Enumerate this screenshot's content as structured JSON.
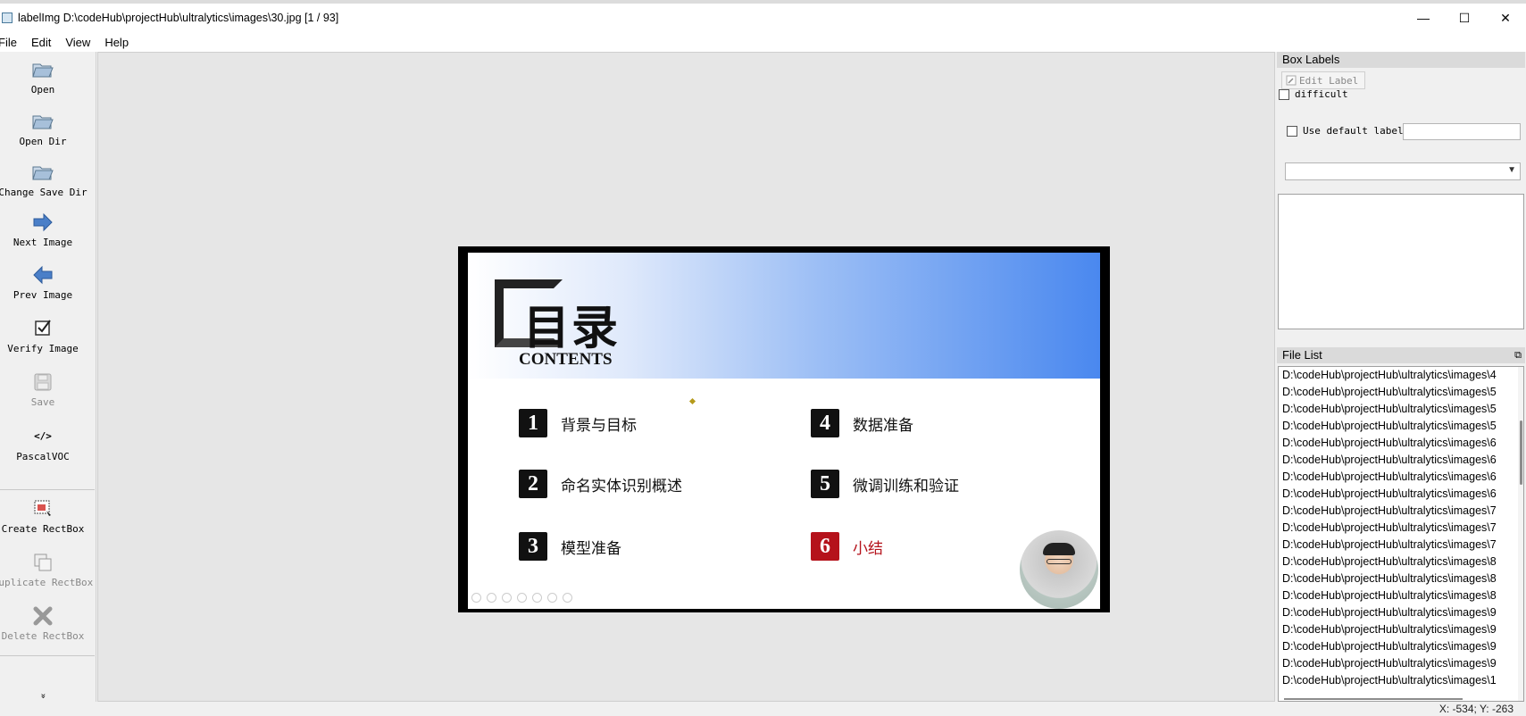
{
  "window": {
    "title": "labelImg D:\\codeHub\\projectHub\\ultralytics\\images\\30.jpg [1 / 93]",
    "minimize": "—",
    "maximize": "☐",
    "close": "✕"
  },
  "menu": [
    "File",
    "Edit",
    "View",
    "Help"
  ],
  "toolbar": {
    "open": "Open",
    "open_dir": "Open Dir",
    "change_save_dir": "Change Save Dir",
    "next_image": "Next Image",
    "prev_image": "Prev Image",
    "verify_image": "Verify Image",
    "save": "Save",
    "format_icon": "</>",
    "format": "PascalVOC",
    "create_rectbox": "Create RectBox",
    "duplicate_rectbox": "Duplicate RectBox",
    "delete_rectbox": "Delete RectBox",
    "more": "»"
  },
  "slide": {
    "title": "目录",
    "subtitle": "CONTENTS",
    "items": [
      {
        "num": "1",
        "text": "背景与目标"
      },
      {
        "num": "2",
        "text": "命名实体识别概述"
      },
      {
        "num": "3",
        "text": "模型准备"
      },
      {
        "num": "4",
        "text": "数据准备"
      },
      {
        "num": "5",
        "text": "微调训练和验证"
      },
      {
        "num": "6",
        "text": "小结"
      }
    ],
    "accent_color": "#b5121b"
  },
  "box_labels": {
    "title": "Box Labels",
    "edit_label": "Edit Label",
    "difficult": "difficult",
    "use_default_label": "Use default label",
    "default_label_value": ""
  },
  "file_list": {
    "title": "File List",
    "files": [
      "D:\\codeHub\\projectHub\\ultralytics\\images\\4",
      "D:\\codeHub\\projectHub\\ultralytics\\images\\5",
      "D:\\codeHub\\projectHub\\ultralytics\\images\\5",
      "D:\\codeHub\\projectHub\\ultralytics\\images\\5",
      "D:\\codeHub\\projectHub\\ultralytics\\images\\6",
      "D:\\codeHub\\projectHub\\ultralytics\\images\\6",
      "D:\\codeHub\\projectHub\\ultralytics\\images\\6",
      "D:\\codeHub\\projectHub\\ultralytics\\images\\6",
      "D:\\codeHub\\projectHub\\ultralytics\\images\\7",
      "D:\\codeHub\\projectHub\\ultralytics\\images\\7",
      "D:\\codeHub\\projectHub\\ultralytics\\images\\7",
      "D:\\codeHub\\projectHub\\ultralytics\\images\\8",
      "D:\\codeHub\\projectHub\\ultralytics\\images\\8",
      "D:\\codeHub\\projectHub\\ultralytics\\images\\8",
      "D:\\codeHub\\projectHub\\ultralytics\\images\\9",
      "D:\\codeHub\\projectHub\\ultralytics\\images\\9",
      "D:\\codeHub\\projectHub\\ultralytics\\images\\9",
      "D:\\codeHub\\projectHub\\ultralytics\\images\\9",
      "D:\\codeHub\\projectHub\\ultralytics\\images\\1"
    ]
  },
  "status": "X: -534; Y: -263"
}
